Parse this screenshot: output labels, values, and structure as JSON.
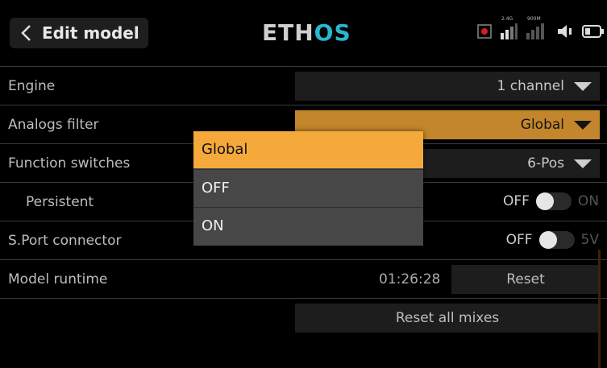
{
  "header": {
    "title": "Edit model",
    "logo_main": "ETH",
    "logo_accent": "OS",
    "status": {
      "band_a": "2.4G",
      "band_b": "900M"
    }
  },
  "rows": {
    "engine": {
      "label": "Engine",
      "value": "1 channel"
    },
    "analogs_filter": {
      "label": "Analogs filter",
      "value": "Global"
    },
    "function_switches": {
      "label": "Function switches",
      "value": "6-Pos"
    },
    "persistent": {
      "label": "Persistent",
      "off": "OFF",
      "on": "ON"
    },
    "sport_connector": {
      "label": "S.Port connector",
      "off": "OFF",
      "on": "5V"
    },
    "model_runtime": {
      "label": "Model runtime",
      "value": "01:26:28",
      "reset_label": "Reset"
    },
    "reset_all": {
      "label": "Reset all mixes"
    }
  },
  "dropdown": {
    "options": [
      "Global",
      "OFF",
      "ON"
    ],
    "selected": "Global"
  },
  "colors": {
    "accent": "#f5a93a",
    "field_active": "#c3862c",
    "logo_accent": "#2ab7ce"
  }
}
